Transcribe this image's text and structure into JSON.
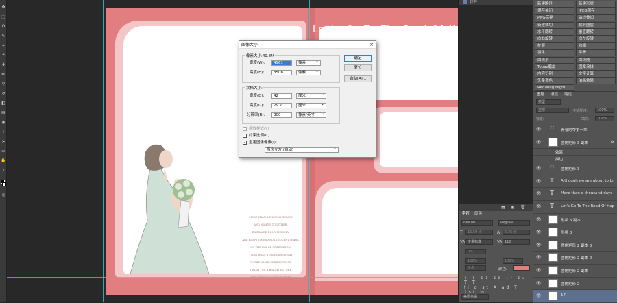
{
  "canvas": {
    "heading": "Let's Go To The Road Of Ha",
    "poem_lines": [
      "MORE THAN A THOUSAND DAYS",
      "AND NIGHTS TOGETHER,",
      "ENGRAVED IN MY MEMORY,",
      "ARE HAPPY TIMES AND INNOCENT YEARS.",
      "ON THE DAY OF GRADUATION,",
      "I JUST WANT TO SINCERELY SAY",
      "IN THE NAME OF FRIENDSHIP",
      "I WISH YOU A BRIGHT FUTURE",
      "AND SEE YOU IN THE FUTURE"
    ],
    "colors": {
      "pink": "#e27d80",
      "light_pink": "#f4c6c8",
      "white": "#ffffff"
    }
  },
  "dialog": {
    "title": "图像大小",
    "close": "×",
    "pixel_dimensions_label": "像素大小:49.8M",
    "width_label": "宽度(W):",
    "width_value": "4961",
    "width_unit": "像素",
    "height_label": "高度(H):",
    "height_value": "3508",
    "height_unit": "像素",
    "doc_size_label": "文档大小:",
    "doc_width_label": "宽度(D):",
    "doc_width_value": "42",
    "doc_width_unit": "厘米",
    "doc_height_label": "高度(G):",
    "doc_height_value": "29.7",
    "doc_height_unit": "厘米",
    "resolution_label": "分辨率(R):",
    "resolution_value": "300",
    "resolution_unit": "像素/英寸",
    "scale_styles_label": "缩放样式(Y)",
    "constrain_label": "约束比例(C)",
    "resample_label": "重定图像像素(I):",
    "resample_method": "两次立方 (自动)",
    "ok": "确定",
    "reset": "复位",
    "auto": "自动(A)..."
  },
  "top_strip": {
    "label": "打开"
  },
  "actions": [
    [
      "新建路径",
      "新建形状"
    ],
    [
      "保存关闭",
      "JPEG保存"
    ],
    [
      "PNG保存",
      "曲线叠加"
    ],
    [
      "新建裁切",
      "裁剪图层"
    ],
    [
      "水平翻转",
      "垂直翻转"
    ],
    [
      "向右旋转",
      "向左旋转"
    ],
    [
      "扩展",
      "收缩"
    ],
    [
      "羽化",
      "平滑"
    ],
    [
      "曲线系",
      "曲线随"
    ],
    [
      "Topaz磨皮",
      "图章涂抹"
    ],
    [
      "内容识别",
      "文字计算"
    ],
    [
      "矢量调色",
      "油画效果"
    ],
    [
      "Reduong Highl...",
      ""
    ]
  ],
  "layers_panel": {
    "tabs": [
      "图层",
      "通道",
      "路径"
    ],
    "kind": "类型",
    "blend": "正常",
    "opacity_label": "不透明度:",
    "opacity": "100%",
    "lock_label": "锁定:",
    "fill_label": "填充:",
    "fill": "100%",
    "layers": [
      {
        "name": "青春的夺第一章",
        "type": "group"
      },
      {
        "name": "圆角矩形 3 副本",
        "type": "shape",
        "fx": "fx"
      },
      {
        "name": "效果",
        "type": "effect"
      },
      {
        "name": "描边",
        "type": "effect"
      },
      {
        "name": "圆角矩形 3",
        "type": "group"
      },
      {
        "name": "Although we are about to br...",
        "type": "text"
      },
      {
        "name": "More than a thousand days a...",
        "type": "text"
      },
      {
        "name": "Let's Go To The Road Of Hap...",
        "type": "text"
      },
      {
        "name": "形状 3 副本",
        "type": "shape"
      },
      {
        "name": "形状 3",
        "type": "shape"
      },
      {
        "name": "圆角矩形 2 副本 3",
        "type": "shape"
      },
      {
        "name": "圆角矩形 2 副本 2",
        "type": "shape"
      },
      {
        "name": "圆角矩形 2 副本",
        "type": "shape"
      },
      {
        "name": "圆角矩形 2",
        "type": "shape"
      },
      {
        "name": "17",
        "type": "image"
      }
    ]
  },
  "character_panel": {
    "tabs": [
      "字符",
      "段落"
    ],
    "font": "Bell MT",
    "style": "Regular",
    "size": "15.59 点",
    "leading": "6.36 点",
    "kerning": "度量标准",
    "tracking": "110",
    "vscale": "0%",
    "hscale": "100%",
    "baseline": "100%",
    "baseline_shift": "0 点",
    "color_label": "颜色:",
    "bottom_label": "美国英语"
  }
}
